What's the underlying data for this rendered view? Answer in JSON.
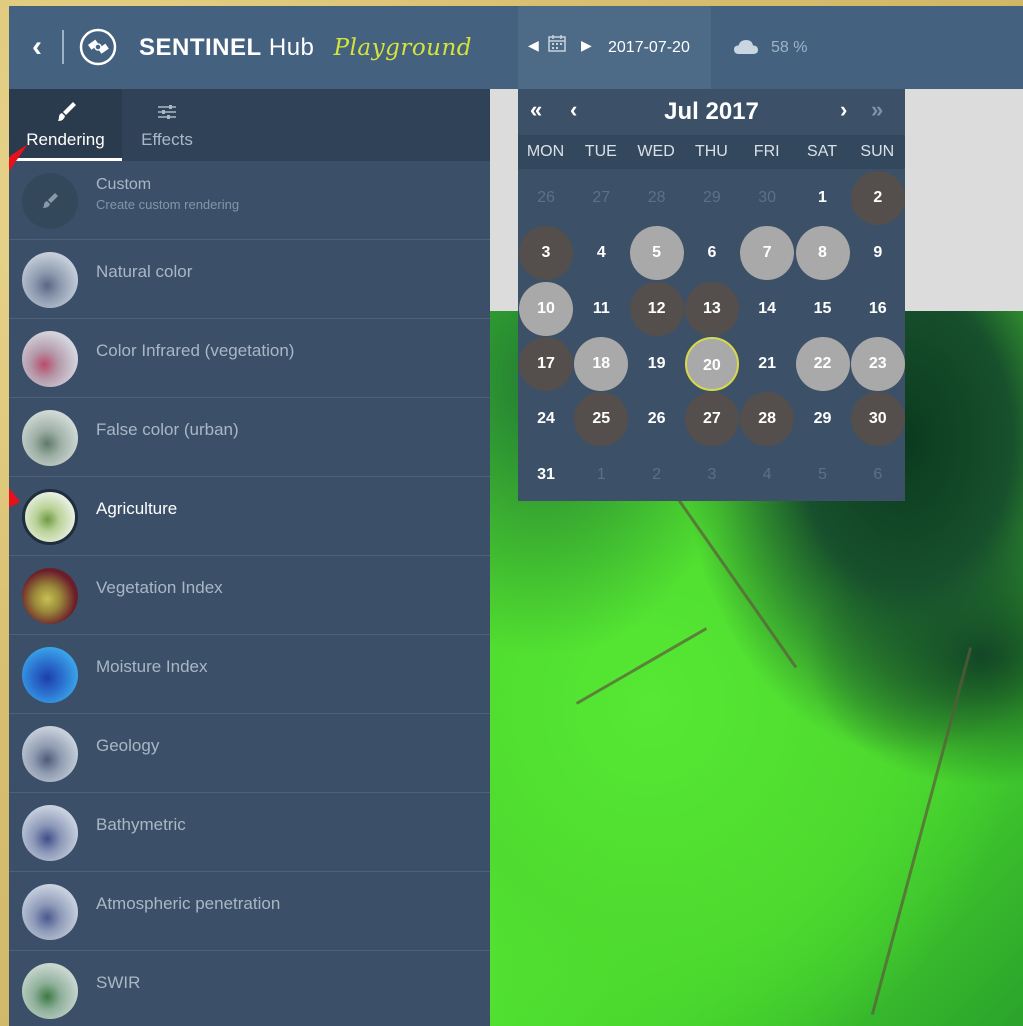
{
  "header": {
    "brand_sentinel": "SENTINEL",
    "brand_hub": "Hub",
    "brand_playground": "Playground",
    "date": "2017-07-20",
    "cloud_coverage": "58 %",
    "back_icon": "back-icon",
    "date_prev_icon": "caret-left-icon",
    "date_next_icon": "caret-right-icon",
    "calendar_icon": "calendar-icon",
    "cloud_icon": "cloud-icon"
  },
  "tabs": [
    {
      "label": "Rendering",
      "icon": "paintbrush-icon",
      "active": true
    },
    {
      "label": "Effects",
      "icon": "sliders-icon",
      "active": false
    }
  ],
  "renderings": [
    {
      "label": "Custom",
      "sub": "Create custom rendering",
      "custom": true
    },
    {
      "label": "Natural color"
    },
    {
      "label": "Color Infrared (vegetation)"
    },
    {
      "label": "False color (urban)"
    },
    {
      "label": "Agriculture",
      "selected": true
    },
    {
      "label": "Vegetation Index"
    },
    {
      "label": "Moisture Index"
    },
    {
      "label": "Geology"
    },
    {
      "label": "Bathymetric"
    },
    {
      "label": "Atmospheric penetration"
    },
    {
      "label": "SWIR"
    }
  ],
  "calendar": {
    "title": "Jul 2017",
    "nav_prev_year": "«",
    "nav_prev_month": "‹",
    "nav_next_month": "›",
    "nav_next_year": "»",
    "weekdays": [
      "MON",
      "TUE",
      "WED",
      "THU",
      "FRI",
      "SAT",
      "SUN"
    ],
    "weeks": [
      [
        [
          "26",
          "muted"
        ],
        [
          "27",
          "muted"
        ],
        [
          "28",
          "muted"
        ],
        [
          "29",
          "muted"
        ],
        [
          "30",
          "muted"
        ],
        [
          "1",
          "plain"
        ],
        [
          "2",
          "dark"
        ]
      ],
      [
        [
          "3",
          "dark"
        ],
        [
          "4",
          "plain"
        ],
        [
          "5",
          "light"
        ],
        [
          "6",
          "plain"
        ],
        [
          "7",
          "light"
        ],
        [
          "8",
          "light"
        ],
        [
          "9",
          "plain"
        ]
      ],
      [
        [
          "10",
          "light"
        ],
        [
          "11",
          "plain"
        ],
        [
          "12",
          "dark"
        ],
        [
          "13",
          "dark"
        ],
        [
          "14",
          "plain"
        ],
        [
          "15",
          "plain"
        ],
        [
          "16",
          "plain"
        ]
      ],
      [
        [
          "17",
          "dark"
        ],
        [
          "18",
          "light"
        ],
        [
          "19",
          "plain"
        ],
        [
          "20",
          "selected"
        ],
        [
          "21",
          "plain"
        ],
        [
          "22",
          "light"
        ],
        [
          "23",
          "light"
        ]
      ],
      [
        [
          "24",
          "plain"
        ],
        [
          "25",
          "dark"
        ],
        [
          "26",
          "plain"
        ],
        [
          "27",
          "dark"
        ],
        [
          "28",
          "dark"
        ],
        [
          "29",
          "plain"
        ],
        [
          "30",
          "dark"
        ]
      ],
      [
        [
          "31",
          "plain"
        ],
        [
          "1",
          "muted"
        ],
        [
          "2",
          "muted"
        ],
        [
          "3",
          "muted"
        ],
        [
          "4",
          "muted"
        ],
        [
          "5",
          "muted"
        ],
        [
          "6",
          "muted"
        ]
      ]
    ]
  },
  "colors": {
    "topbar": "#44627f",
    "sidebar": "#3b5068",
    "accent_yellow": "#d6e33a",
    "annotation_arrow": "#e8101a"
  }
}
